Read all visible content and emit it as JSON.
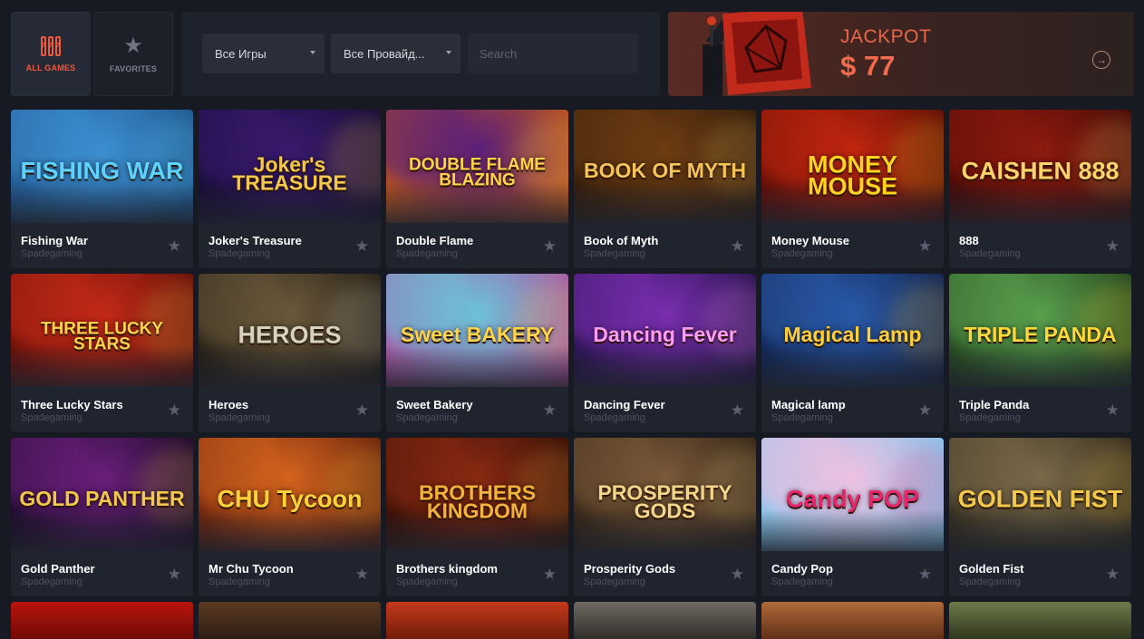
{
  "categories": [
    {
      "label": "ALL GAMES",
      "icon": "slot-machine-icon",
      "active": true
    },
    {
      "label": "FAVORITES",
      "icon": "star-icon",
      "active": false
    }
  ],
  "filters": {
    "games_select": "Все Игры",
    "providers_select": "Все Провайд...",
    "search_placeholder": "Search"
  },
  "jackpot": {
    "title": "JACKPOT",
    "value": "$ 77",
    "accent": "#ef5a3c"
  },
  "games": [
    {
      "title": "Fishing War",
      "provider": "Spadegaming",
      "art": "FISHING WAR",
      "bg": [
        "#3d8fd0",
        "#1b4f86"
      ],
      "artColor": "#5fd3ff"
    },
    {
      "title": "Joker's Treasure",
      "provider": "Spadegaming",
      "art": "Joker's TREASURE",
      "bg": [
        "#3a1a6e",
        "#120a2e"
      ],
      "artColor": "#f4c84a"
    },
    {
      "title": "Double Flame",
      "provider": "Spadegaming",
      "art": "DOUBLE FLAME BLAZING",
      "bg": [
        "#5a1f7a",
        "#c65a12"
      ],
      "artColor": "#ffd34a"
    },
    {
      "title": "Book of Myth",
      "provider": "Spadegaming",
      "art": "BOOK OF MYTH",
      "bg": [
        "#6e3d12",
        "#2a170a"
      ],
      "artColor": "#f5c35a"
    },
    {
      "title": "Money Mouse",
      "provider": "Spadegaming",
      "art": "MONEY MOUSE",
      "bg": [
        "#c2260f",
        "#4e0a06"
      ],
      "artColor": "#ffd21f"
    },
    {
      "title": "888",
      "provider": "Spadegaming",
      "art": "CAISHEN 888",
      "bg": [
        "#8e1a0e",
        "#3a0805"
      ],
      "artColor": "#ffd36a"
    },
    {
      "title": "Three Lucky Stars",
      "provider": "Spadegaming",
      "art": "THREE LUCKY STARS",
      "bg": [
        "#c42a18",
        "#5a0c08"
      ],
      "artColor": "#ffd34a"
    },
    {
      "title": "Heroes",
      "provider": "Spadegaming",
      "art": "HEROES",
      "bg": [
        "#6b5a3c",
        "#1a150e"
      ],
      "artColor": "#d9d1c0"
    },
    {
      "title": "Sweet Bakery",
      "provider": "Spadegaming",
      "art": "Sweet BAKERY",
      "bg": [
        "#6bc4d9",
        "#b04a9e"
      ],
      "artColor": "#ffd34a"
    },
    {
      "title": "Dancing Fever",
      "provider": "Spadegaming",
      "art": "Dancing Fever",
      "bg": [
        "#7a2fb0",
        "#1b0e40"
      ],
      "artColor": "#ff9bf0"
    },
    {
      "title": "Magical lamp",
      "provider": "Spadegaming",
      "art": "Magical Lamp",
      "bg": [
        "#2a5aa8",
        "#0e1d46"
      ],
      "artColor": "#ffcf3a"
    },
    {
      "title": "Triple Panda",
      "provider": "Spadegaming",
      "art": "TRIPLE PANDA",
      "bg": [
        "#5aa04e",
        "#1c3a18"
      ],
      "artColor": "#ffd83a"
    },
    {
      "title": "Gold Panther",
      "provider": "Spadegaming",
      "art": "GOLD PANTHER",
      "bg": [
        "#6a1f7a",
        "#12081e"
      ],
      "artColor": "#f4c84a"
    },
    {
      "title": "Mr Chu Tycoon",
      "provider": "Spadegaming",
      "art": "CHU Tycoon",
      "bg": [
        "#d4641e",
        "#5a180a"
      ],
      "artColor": "#ffd23a"
    },
    {
      "title": "Brothers kingdom",
      "provider": "Spadegaming",
      "art": "BROTHERS KINGDOM",
      "bg": [
        "#8a2a12",
        "#2a0c06"
      ],
      "artColor": "#f4b23a"
    },
    {
      "title": "Prosperity Gods",
      "provider": "Spadegaming",
      "art": "PROSPERITY GODS",
      "bg": [
        "#7a5a3a",
        "#2a1c10"
      ],
      "artColor": "#f5d58a"
    },
    {
      "title": "Candy Pop",
      "provider": "Spadegaming",
      "art": "Candy POP",
      "bg": [
        "#f0c0e0",
        "#7ac8f0"
      ],
      "artColor": "#e8256a"
    },
    {
      "title": "Golden Fist",
      "provider": "Spadegaming",
      "art": "GOLDEN FIST",
      "bg": [
        "#7a6a4a",
        "#2a2418"
      ],
      "artColor": "#f4c84a"
    }
  ],
  "partial_row": [
    {
      "bg": [
        "#b8140e",
        "#6a0a06"
      ]
    },
    {
      "bg": [
        "#5a3a22",
        "#2a1a10"
      ]
    },
    {
      "bg": [
        "#c43a1a",
        "#6a1a0a"
      ]
    },
    {
      "bg": [
        "#6e6a60",
        "#2a2824"
      ]
    },
    {
      "bg": [
        "#b06a3a",
        "#5a2a14"
      ]
    },
    {
      "bg": [
        "#6e7a4a",
        "#2a3018"
      ]
    }
  ],
  "favorite_icon": "star-icon"
}
